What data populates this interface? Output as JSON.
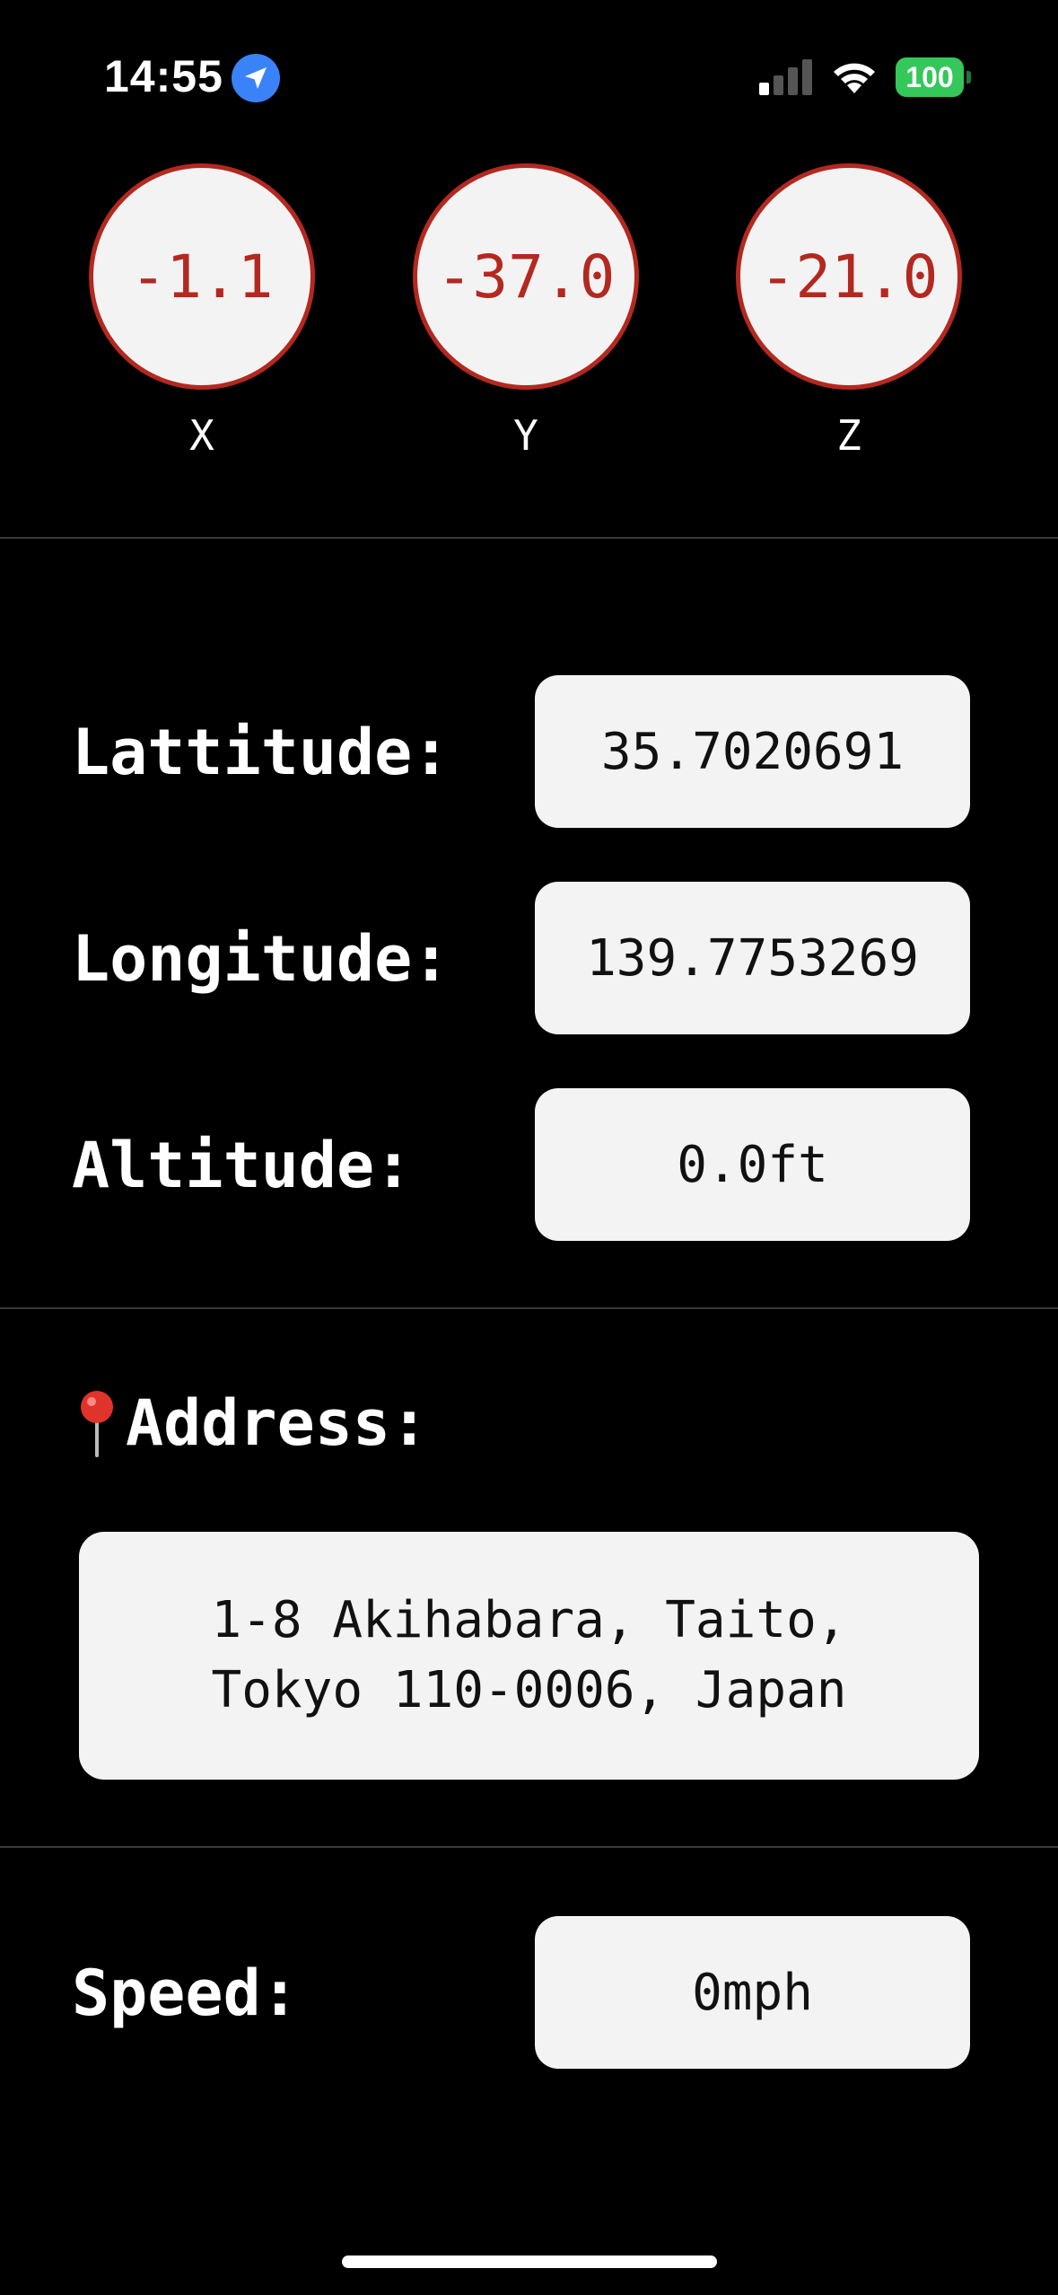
{
  "status_bar": {
    "time": "14:55",
    "battery": "100",
    "colors": {
      "location": "#3a82f7",
      "battery": "#34c759"
    }
  },
  "accelerometer": {
    "x": {
      "value": "-1.1",
      "label": "X"
    },
    "y": {
      "value": "-37.0",
      "label": "Y"
    },
    "z": {
      "value": "-21.0",
      "label": "Z"
    },
    "colors": {
      "ring": "#b3281f",
      "fill": "#f3f3f3"
    }
  },
  "location": {
    "latitude_label": "Lattitude:",
    "latitude_value": "35.7020691",
    "longitude_label": "Longitude:",
    "longitude_value": "139.7753269",
    "altitude_label": "Altitude:",
    "altitude_value": "0.0ft"
  },
  "address": {
    "label": "Address:",
    "icon": "pin-icon",
    "value": "1-8 Akihabara, Taito, Tokyo 110-0006, Japan"
  },
  "speed": {
    "label": "Speed:",
    "value": "0mph"
  }
}
